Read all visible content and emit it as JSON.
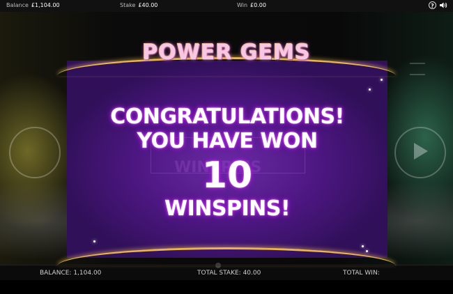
{
  "topbar": {
    "balance_label": "Balance",
    "balance_value": "£1,104.00",
    "stake_label": "Stake",
    "stake_value": "£40.00",
    "win_label": "Win",
    "win_value": "£0.00",
    "help_icon": "help-icon",
    "sound_icon": "speaker-icon"
  },
  "game": {
    "logo": "POWER GEMS",
    "background_watermark": "WINSPINS"
  },
  "popup": {
    "line1": "CONGRATULATIONS!",
    "line2": "YOU HAVE WON",
    "count": "10",
    "line4": "WINSPINS!"
  },
  "bottombar": {
    "balance_label": "BALANCE:",
    "balance_value": "1,104.00",
    "stake_label": "TOTAL STAKE:",
    "stake_value": "40.00",
    "win_label": "TOTAL WIN:",
    "win_value": ""
  },
  "colors": {
    "panel_purple": "#4d1782",
    "arc_gold": "#e8b64c",
    "text_glow": "#b12de0"
  }
}
